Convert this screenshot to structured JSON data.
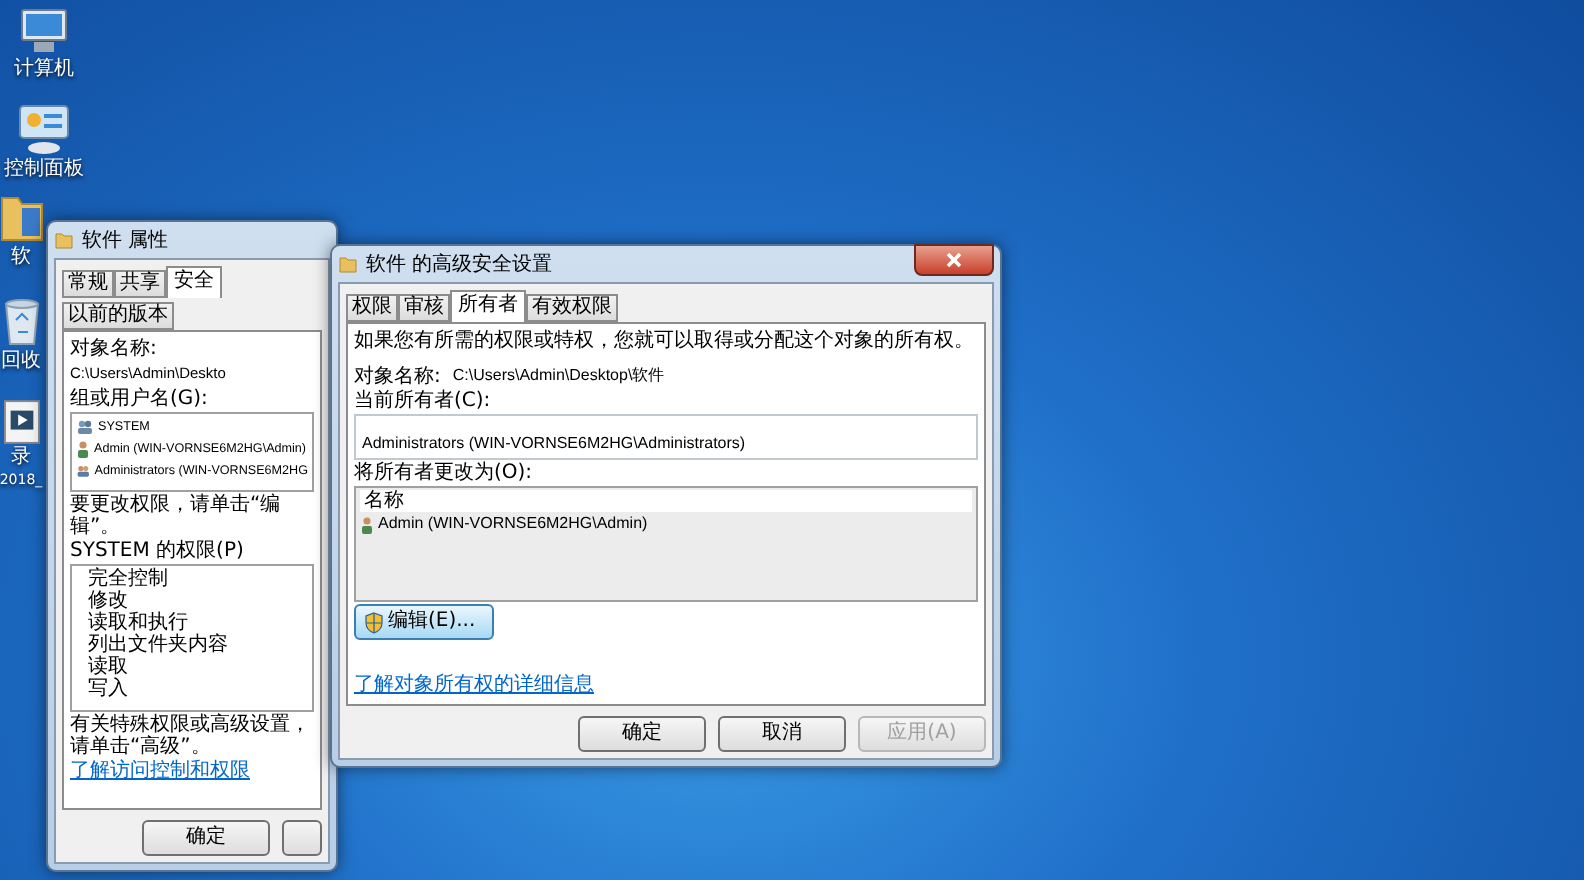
{
  "desktop_icons": [
    {
      "kind": "computer",
      "label": "计算机"
    },
    {
      "kind": "control-panel",
      "label": "控制面板"
    },
    {
      "kind": "folder",
      "label": "软"
    },
    {
      "kind": "recycle-bin",
      "label": "回收"
    },
    {
      "kind": "video",
      "label": "录",
      "label_line_2": "2018_"
    }
  ],
  "properties_window": {
    "title": "软件 属性",
    "tabs": [
      {
        "label": "常规",
        "selected": false
      },
      {
        "label": "共享",
        "selected": false
      },
      {
        "label": "安全",
        "selected": true
      },
      {
        "label": "以前的版本",
        "selected": false
      }
    ],
    "object_name_label": "对象名称:",
    "object_name": "C:\\Users\\Admin\\Deskto",
    "group_label": "组或用户名(G):",
    "users": [
      {
        "kind": "system",
        "name": "SYSTEM"
      },
      {
        "kind": "user",
        "name": "Admin (WIN-VORNSE6M2HG\\Admin)"
      },
      {
        "kind": "group",
        "name": "Administrators (WIN-VORNSE6M2HG"
      }
    ],
    "edit_note": "要更改权限，请单击“编辑”。",
    "permissions_label": "SYSTEM 的权限(P)",
    "permissions": [
      "完全控制",
      "修改",
      "读取和执行",
      "列出文件夹内容",
      "读取",
      "写入"
    ],
    "advanced_note": "有关特殊权限或高级设置，请单击“高级”。",
    "link": "了解访问控制和权限",
    "buttons": [
      "确定"
    ]
  },
  "security_window": {
    "title": "软件 的高级安全设置",
    "tabs": [
      {
        "label": "权限",
        "selected": false
      },
      {
        "label": "审核",
        "selected": false
      },
      {
        "label": "所有者",
        "selected": true
      },
      {
        "label": "有效权限",
        "selected": false
      }
    ],
    "intro": "如果您有所需的权限或特权，您就可以取得或分配这个对象的所有权。",
    "object_name_label": "对象名称:",
    "object_name": "C:\\Users\\Admin\\Desktop\\软件",
    "current_owner_label": "当前所有者(C):",
    "current_owner": "Administrators (WIN-VORNSE6M2HG\\Administrators)",
    "change_owner_label": "将所有者更改为(O):",
    "list_header": "名称",
    "owners": [
      {
        "kind": "user",
        "name": "Admin (WIN-VORNSE6M2HG\\Admin)"
      }
    ],
    "edit_button": "编辑(E)...",
    "link": "了解对象所有权的详细信息",
    "buttons": [
      {
        "label": "确定",
        "disabled": false
      },
      {
        "label": "取消",
        "disabled": false
      },
      {
        "label": "应用(A)",
        "disabled": true
      }
    ]
  }
}
